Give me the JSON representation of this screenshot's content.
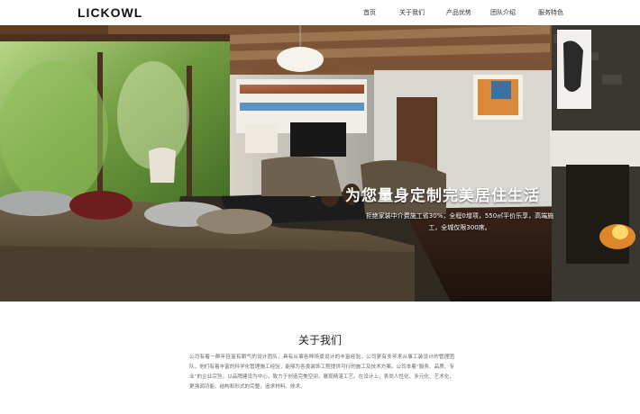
{
  "header": {
    "logo": "LICKOWL",
    "nav": [
      {
        "label": "首页"
      },
      {
        "label": "关于我们"
      },
      {
        "label": "产品优势"
      },
      {
        "label": "团队介绍"
      },
      {
        "label": "服务特色"
      }
    ]
  },
  "hero": {
    "slogan": "为您量身定制完美居住生活",
    "subline": "拒绝家装中介费施工省30%，全程0增项，550㎡平价乐享，高端施工，全城仅限300席。"
  },
  "about": {
    "title": "关于我们",
    "text": "公司有着一群年轻富有朝气的设计团队，具有从事各种场景设计的丰富经验，公司更有多年来从事工装设计的管理团队，他们有着丰富的科学化管理施工经验，能够为各类装饰工程提供可行的施工及技术方案。公司本着“服务、品质、专业”的企业宗旨，以品牌建设为中心，致力于创造完美空间，展现精湛工艺。在设计上，表尚人性化、多元化、艺术化，更强调功能、结构和形式的完整，追求材料、技术、"
  },
  "colors": {
    "header_bg": "#ffffff",
    "text_dark": "#222222",
    "hero_text": "#ffffff"
  }
}
